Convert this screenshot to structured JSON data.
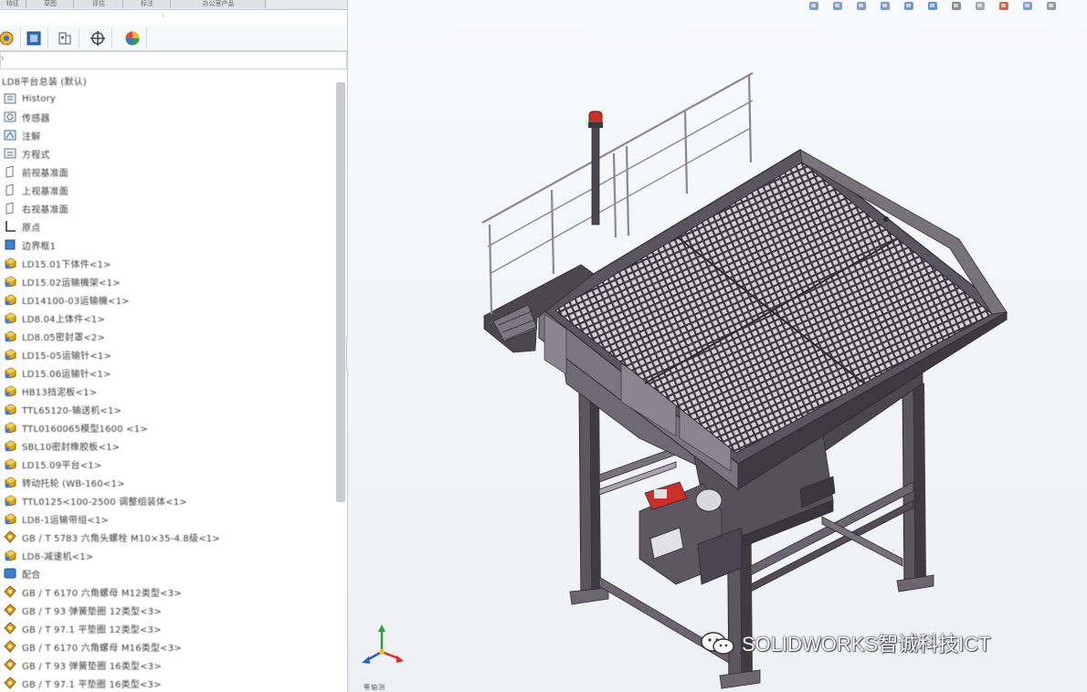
{
  "panel": {
    "top_tabs": [
      "特征",
      "草图",
      "评估",
      "标注",
      "办公室产品"
    ],
    "icon_tabs": [
      "feature-manager-icon",
      "property-manager-icon",
      "configuration-manager-icon",
      "dimxpert-icon",
      "display-manager-icon"
    ],
    "tree_root": "LD8平台总装 (默认)",
    "tree": [
      {
        "label": "History",
        "icon": "history-icon"
      },
      {
        "label": "传感器",
        "icon": "sensor-icon"
      },
      {
        "label": "注解",
        "icon": "annotation-icon"
      },
      {
        "label": "方程式",
        "icon": "equation-icon"
      },
      {
        "label": "前视基准面",
        "icon": "plane-icon"
      },
      {
        "label": "上视基准面",
        "icon": "plane-icon"
      },
      {
        "label": "右视基准面",
        "icon": "plane-icon"
      },
      {
        "label": "原点",
        "icon": "origin-icon"
      },
      {
        "label": "边界框1",
        "icon": "body-icon"
      },
      {
        "label": "LD15.01下体件<1>",
        "icon": "part-icon"
      },
      {
        "label": "LD15.02运输機架<1>",
        "icon": "part-icon"
      },
      {
        "label": "LD14100-03运输機<1>",
        "icon": "part-icon"
      },
      {
        "label": "LD8.04上体件<1>",
        "icon": "part-icon"
      },
      {
        "label": "LD8.05密封罩<2>",
        "icon": "part-icon"
      },
      {
        "label": "LD15-05运输针<1>",
        "icon": "part-icon"
      },
      {
        "label": "LD15.06运输针<1>",
        "icon": "part-icon"
      },
      {
        "label": "HB13挡泥板<1>",
        "icon": "part-icon"
      },
      {
        "label": "TTL65120-输送机<1>",
        "icon": "part-icon"
      },
      {
        "label": "TTL0160065模型1600   <1>",
        "icon": "part-icon"
      },
      {
        "label": "SBL10密封橡胶板<1>",
        "icon": "part-icon"
      },
      {
        "label": "LD15.09平台<1>",
        "icon": "part-icon"
      },
      {
        "label": "转动托轮 (WB-160<1>",
        "icon": "part-icon"
      },
      {
        "label": "TTL0125<100-2500 调整组装体<1>",
        "icon": "part-icon"
      },
      {
        "label": "LD8-1运输带组<1>",
        "icon": "part-icon"
      },
      {
        "label": "GB / T 5783 六角头螺栓 M10×35-4.8级<1>",
        "icon": "toolbox-icon"
      },
      {
        "label": "LD8-减速机<1>",
        "icon": "part-icon"
      },
      {
        "label": "配合",
        "icon": "mates-icon"
      },
      {
        "label": "GB / T 6170 六角螺母 M12类型<3>",
        "icon": "toolbox-icon"
      },
      {
        "label": "GB / T 93 弹簧垫圈 12类型<3>",
        "icon": "toolbox-icon"
      },
      {
        "label": "GB / T 97.1 平垫圈 12类型<3>",
        "icon": "toolbox-icon"
      },
      {
        "label": "GB / T 6170 六角螺母 M16类型<3>",
        "icon": "toolbox-icon"
      },
      {
        "label": "GB / T 93 弹簧垫圈 16类型<3>",
        "icon": "toolbox-icon"
      },
      {
        "label": "GB / T 97.1 平垫圈 16类型<3>",
        "icon": "toolbox-icon"
      }
    ]
  },
  "viewport": {
    "heads_up_tools": [
      "zoom-to-fit-icon",
      "zoom-area-icon",
      "previous-view-icon",
      "section-view-icon",
      "view-orientation-icon",
      "display-style-icon",
      "hide-show-icon",
      "appearance-icon",
      "scene-icon",
      "view-settings-icon",
      "minimize-icon"
    ],
    "watermark": "SOLIDWORKS智诚科技ICT",
    "triad_label": "等轴测"
  },
  "colors": {
    "frame": "#4a4550",
    "frame_light": "#77727c",
    "grating": "#3b3842",
    "rail": "#8c8791",
    "accent_red": "#c8302a",
    "part_icon": "#d9a520"
  }
}
